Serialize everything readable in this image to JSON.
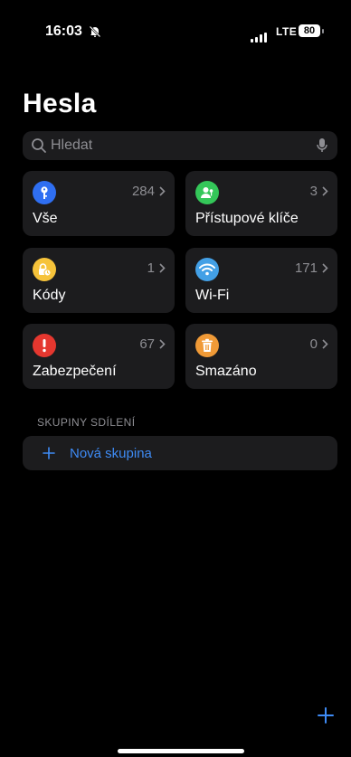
{
  "status_bar": {
    "time": "16:03",
    "network": "LTE",
    "battery": "80"
  },
  "header": {
    "title": "Hesla"
  },
  "search": {
    "placeholder": "Hledat"
  },
  "tiles": [
    {
      "label": "Vše",
      "count": "284",
      "icon": "key-icon",
      "color": "#2f6ff2"
    },
    {
      "label": "Přístupové klíče",
      "count": "3",
      "icon": "passkey-person-icon",
      "color": "#34c759"
    },
    {
      "label": "Kódy",
      "count": "1",
      "icon": "lock-clock-icon",
      "color": "#f6c33a"
    },
    {
      "label": "Wi-Fi",
      "count": "171",
      "icon": "wifi-icon",
      "color": "#43a0e6"
    },
    {
      "label": "Zabezpečení",
      "count": "67",
      "icon": "exclamation-icon",
      "color": "#e5372f"
    },
    {
      "label": "Smazáno",
      "count": "0",
      "icon": "trash-icon",
      "color": "#f09a37"
    }
  ],
  "sharing": {
    "section_title": "SKUPINY SDÍLENÍ",
    "new_group_label": "Nová skupina"
  },
  "colors": {
    "accent": "#3e8bf5",
    "background": "#000000",
    "card": "#1c1c1e"
  }
}
